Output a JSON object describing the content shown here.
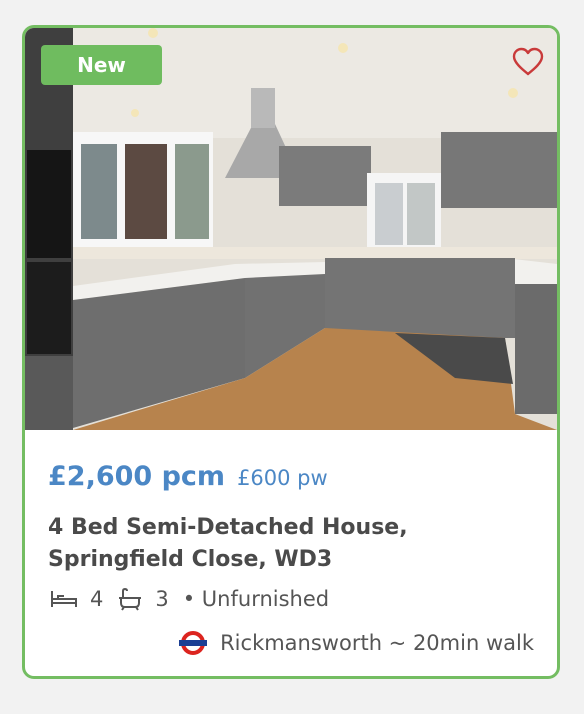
{
  "listing": {
    "badge": "New",
    "price": "£2,600 pcm",
    "price_weekly": "£600 pw",
    "title_line1": "4 Bed Semi-Detached House,",
    "title_line2": "Springfield Close, WD3",
    "bedrooms": "4",
    "bathrooms": "3",
    "furnishing": "• Unfurnished",
    "station": "Rickmansworth ~ 20min walk"
  },
  "colors": {
    "accent_green": "#74bd62",
    "price_blue": "#4b87c5",
    "favourite_red": "#c93a3a",
    "tube_red": "#dc241f",
    "tube_blue": "#1c3f94"
  },
  "icons": {
    "favourite": "heart-outline-icon",
    "bed": "bed-icon",
    "bath": "bath-icon",
    "station": "underground-roundel-icon"
  }
}
